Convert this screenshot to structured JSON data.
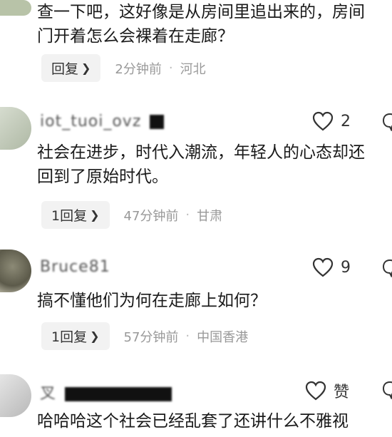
{
  "comments": [
    {
      "text_lines": [
        "查一下吧，这好像是从房间里追出来的，房间",
        "门开着怎么会裸着在走廊？"
      ],
      "reply_label": "回复",
      "time": "2分钟前",
      "location": "河北"
    },
    {
      "username": "iot_tuoi_ovz",
      "likes": "2",
      "text_lines": [
        "社会在进步，时代入潮流，年轻人的心态却还",
        "回到了原始时代。"
      ],
      "reply_label": "1回复",
      "time": "47分钟前",
      "location": "甘肃"
    },
    {
      "username": "Bruce81",
      "likes": "9",
      "text_lines": [
        "搞不懂他们为何在走廊上如何？"
      ],
      "reply_label": "1回复",
      "time": "57分钟前",
      "location": "中国香港"
    },
    {
      "username": "叉",
      "likes": "赞",
      "text_lines": [
        "哈哈哈这个社会已经乱套了还讲什么不雅视"
      ]
    }
  ],
  "icons": {
    "like": "heart-outline-icon",
    "comment": "comment-bubble-icon",
    "reply_chevron": "chevron-right-icon"
  },
  "colors": {
    "text": "#1a1a1a",
    "meta": "#999999",
    "reply_bg": "#f2f2f2"
  }
}
